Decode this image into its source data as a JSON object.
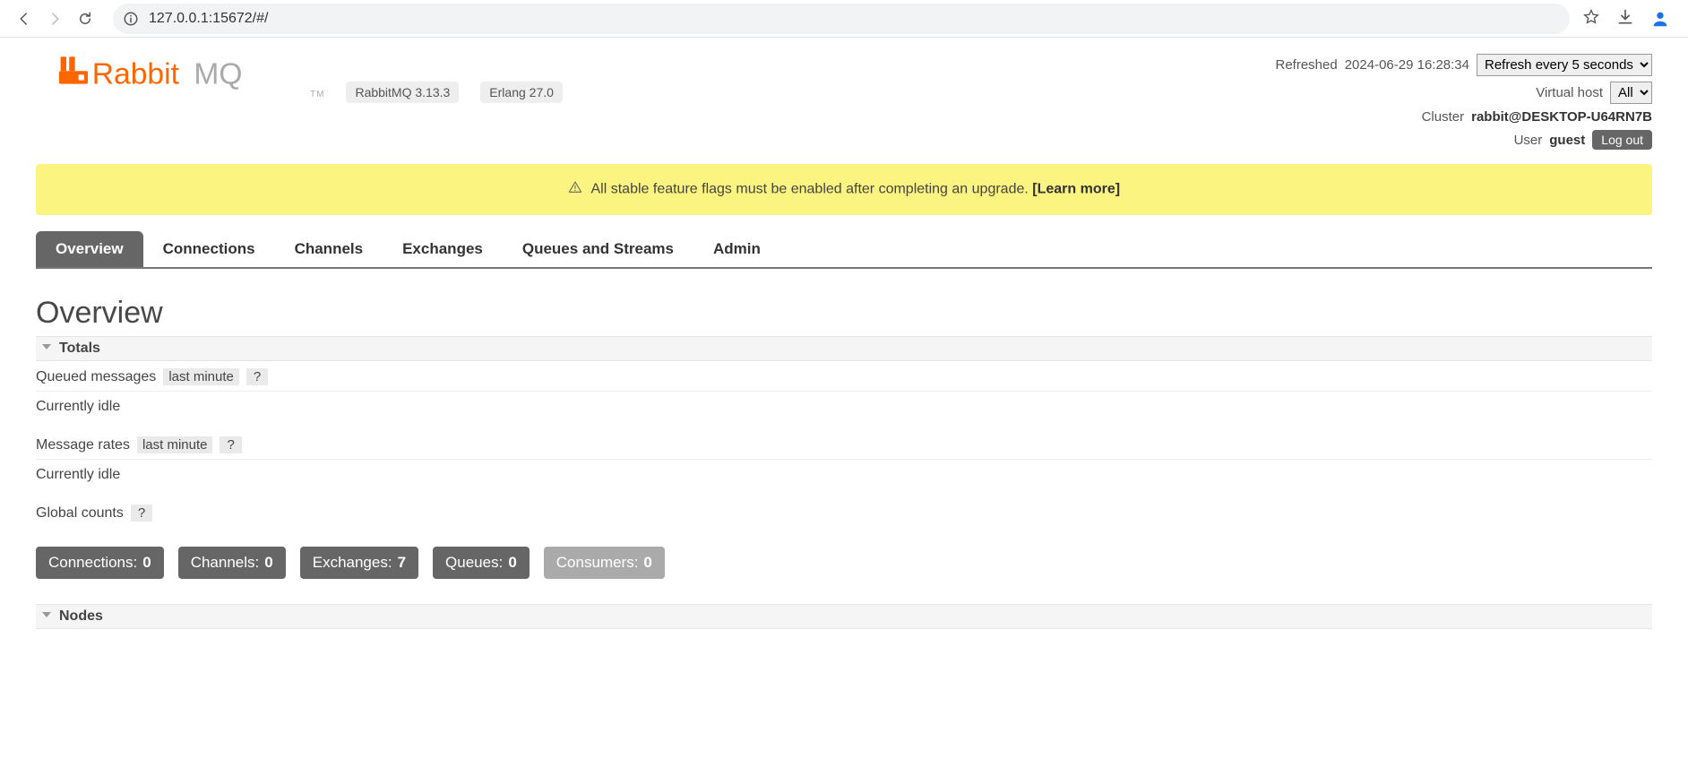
{
  "browser": {
    "url": "127.0.0.1:15672/#/"
  },
  "app": {
    "brand_orange": "Rabbit",
    "brand_grey": "MQ",
    "tm": "TM",
    "version_pill": "RabbitMQ 3.13.3",
    "erlang_pill": "Erlang 27.0"
  },
  "header": {
    "refreshed_label": "Refreshed",
    "refreshed_value": "2024-06-29 16:28:34",
    "refresh_select": "Refresh every 5 seconds",
    "vhost_label": "Virtual host",
    "vhost_value": "All",
    "cluster_label": "Cluster",
    "cluster_value": "rabbit@DESKTOP-U64RN7B",
    "user_label": "User",
    "user_value": "guest",
    "logout": "Log out"
  },
  "alert": {
    "text": "All stable feature flags must be enabled after completing an upgrade.",
    "link": "[Learn more]"
  },
  "tabs": [
    "Overview",
    "Connections",
    "Channels",
    "Exchanges",
    "Queues and Streams",
    "Admin"
  ],
  "content": {
    "page_title": "Overview",
    "section_totals": "Totals",
    "queued_label": "Queued messages",
    "queued_tag": "last minute",
    "help": "?",
    "idle1": "Currently idle",
    "rates_label": "Message rates",
    "rates_tag": "last minute",
    "idle2": "Currently idle",
    "global_label": "Global counts",
    "counts": [
      {
        "label": "Connections:",
        "value": "0"
      },
      {
        "label": "Channels:",
        "value": "0"
      },
      {
        "label": "Exchanges:",
        "value": "7"
      },
      {
        "label": "Queues:",
        "value": "0"
      },
      {
        "label": "Consumers:",
        "value": "0",
        "muted": true
      }
    ],
    "section_nodes": "Nodes"
  }
}
